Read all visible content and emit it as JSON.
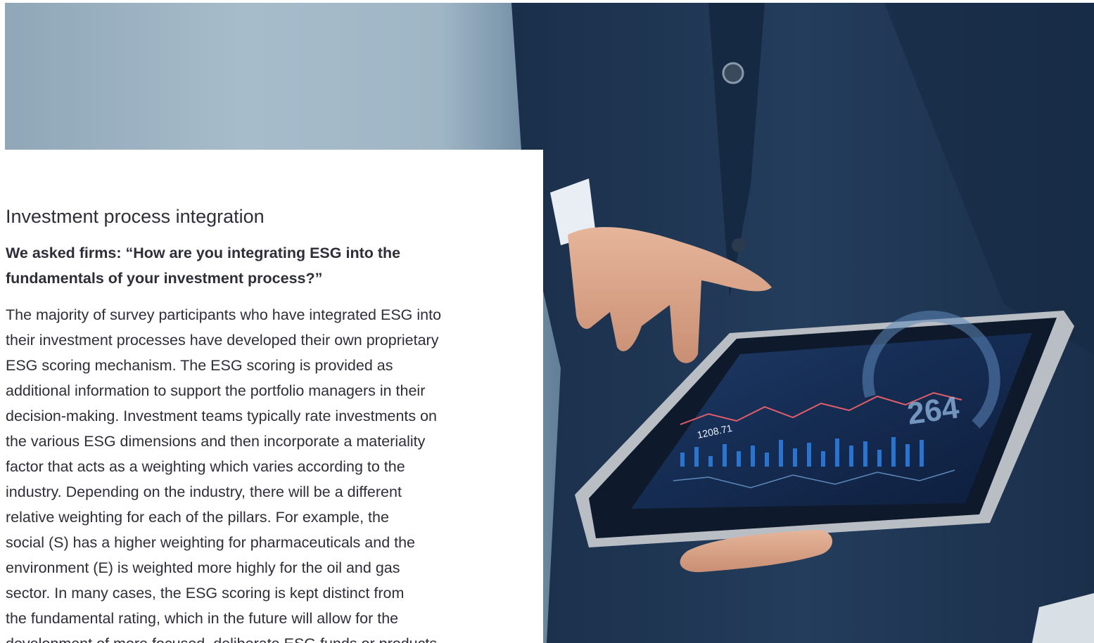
{
  "article": {
    "section_title": "Investment process integration",
    "question": "We asked firms: “How are you integrating ESG into the fundamentals of your investment process?”",
    "question_lines": [
      "We asked firms: “How are you integrating ESG into the",
      "fundamentals of your investment process?”"
    ],
    "body_lines": [
      "The majority of survey participants who have integrated ESG into",
      "their investment processes have developed their own proprietary",
      "ESG scoring mechanism. The ESG scoring is provided as",
      "additional information to support the portfolio managers in their",
      "decision-making. Investment teams typically rate investments on",
      "the various ESG dimensions and then incorporate a materiality",
      "factor that acts as a weighting which varies according to the",
      "industry. Depending on the industry, there will be a different",
      "relative weighting for each of the pillars. For example, the",
      "social (S) has a higher weighting for pharmaceuticals and the",
      "environment (E) is weighted more highly for the oil and gas",
      "sector. In many cases, the ESG scoring is kept distinct from",
      "the fundamental rating, which in the future will allow for the",
      "development of more focused, deliberate ESG funds or products"
    ]
  },
  "hero_image": {
    "subject": "businessman-holding-tablet-with-financial-charts",
    "tablet_figure": "264",
    "tablet_small_value": "1208.71"
  },
  "colors": {
    "text": "#2e2e38",
    "suit": "#1f3552",
    "background_blur": "#a7bccb"
  }
}
